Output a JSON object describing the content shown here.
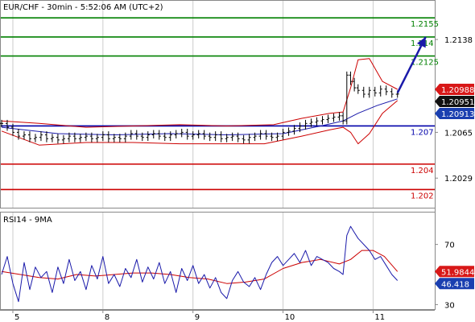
{
  "chart_data": [
    {
      "type": "line",
      "title": "EUR/CHF - 30min - 5:52:06 AM (UTC+2)",
      "subtype": "ohlc-bars",
      "ylim": [
        1.2007,
        1.2164
      ],
      "y_ticks": [
        "1.2138",
        "1.2065",
        "1.2029"
      ],
      "x_ticks": [
        {
          "label": "5",
          "x": 6
        },
        {
          "label": "8",
          "x": 54
        },
        {
          "label": "9",
          "x": 102
        },
        {
          "label": "10",
          "x": 150
        },
        {
          "label": "11",
          "x": 198
        }
      ],
      "xlim": [
        0,
        230
      ],
      "grid": "vertical",
      "levels": [
        {
          "value": 1.2155,
          "label": "1.2155",
          "color": "#008000"
        },
        {
          "value": 1.214,
          "label": "1.214",
          "color": "#008000"
        },
        {
          "value": 1.2125,
          "label": "1.2125",
          "color": "#008000"
        },
        {
          "value": 1.207,
          "label": "1.207",
          "color": "#0000aa"
        },
        {
          "value": 1.204,
          "label": "1.204",
          "color": "#cc0000"
        },
        {
          "value": 1.202,
          "label": "1.202",
          "color": "#cc0000"
        }
      ],
      "price_tags": [
        {
          "value": 1.20988,
          "label": "1.20988",
          "bg": "#d81818",
          "fg": "#ffffff"
        },
        {
          "value": 1.20951,
          "label": "1.20951",
          "bg": "#111111",
          "fg": "#ffffff"
        },
        {
          "value": 1.20913,
          "label": "1.20913",
          "bg": "#1a3fb0",
          "fg": "#ffffff"
        }
      ],
      "arrow": {
        "from": [
          211,
          1.2096
        ],
        "to": [
          226,
          1.214
        ],
        "color": "#1a1aaa"
      },
      "series": [
        {
          "name": "Price",
          "color": "#000000",
          "points": [
            [
              0,
              1.2072
            ],
            [
              3,
              1.2069
            ],
            [
              6,
              1.2065
            ],
            [
              9,
              1.2062
            ],
            [
              12,
              1.2063
            ],
            [
              15,
              1.206
            ],
            [
              18,
              1.2061
            ],
            [
              21,
              1.2063
            ],
            [
              24,
              1.206
            ],
            [
              27,
              1.2061
            ],
            [
              30,
              1.2059
            ],
            [
              33,
              1.206
            ],
            [
              36,
              1.2062
            ],
            [
              39,
              1.206
            ],
            [
              42,
              1.2061
            ],
            [
              45,
              1.2062
            ],
            [
              48,
              1.206
            ],
            [
              51,
              1.2061
            ],
            [
              54,
              1.2063
            ],
            [
              57,
              1.206
            ],
            [
              60,
              1.2061
            ],
            [
              63,
              1.206
            ],
            [
              66,
              1.2062
            ],
            [
              69,
              1.2064
            ],
            [
              72,
              1.2062
            ],
            [
              75,
              1.2061
            ],
            [
              78,
              1.2063
            ],
            [
              81,
              1.2064
            ],
            [
              84,
              1.2062
            ],
            [
              87,
              1.2061
            ],
            [
              90,
              1.2063
            ],
            [
              93,
              1.2064
            ],
            [
              96,
              1.2065
            ],
            [
              99,
              1.2062
            ],
            [
              102,
              1.2063
            ],
            [
              105,
              1.2064
            ],
            [
              108,
              1.2062
            ],
            [
              111,
              1.2061
            ],
            [
              114,
              1.2063
            ],
            [
              117,
              1.206
            ],
            [
              120,
              1.2061
            ],
            [
              123,
              1.2062
            ],
            [
              126,
              1.206
            ],
            [
              129,
              1.2059
            ],
            [
              132,
              1.2061
            ],
            [
              135,
              1.2062
            ],
            [
              138,
              1.2064
            ],
            [
              141,
              1.2062
            ],
            [
              144,
              1.2061
            ],
            [
              147,
              1.2062
            ],
            [
              150,
              1.2065
            ],
            [
              153,
              1.2066
            ],
            [
              156,
              1.2068
            ],
            [
              159,
              1.207
            ],
            [
              162,
              1.2072
            ],
            [
              165,
              1.2073
            ],
            [
              168,
              1.2074
            ],
            [
              171,
              1.2075
            ],
            [
              174,
              1.2076
            ],
            [
              177,
              1.2077
            ],
            [
              180,
              1.2078
            ],
            [
              182,
              1.2074
            ],
            [
              184,
              1.211
            ],
            [
              186,
              1.2105
            ],
            [
              188,
              1.21
            ],
            [
              190,
              1.2098
            ],
            [
              193,
              1.2095
            ],
            [
              196,
              1.2098
            ],
            [
              199,
              1.2096
            ],
            [
              202,
              1.2099
            ],
            [
              205,
              1.2097
            ],
            [
              208,
              1.2095
            ],
            [
              211,
              1.20951
            ]
          ]
        },
        {
          "name": "Bollinger Upper",
          "color": "#cc0000",
          "points": [
            [
              0,
              1.2074
            ],
            [
              20,
              1.2072
            ],
            [
              45,
              1.2069
            ],
            [
              70,
              1.207
            ],
            [
              95,
              1.2071
            ],
            [
              120,
              1.207
            ],
            [
              145,
              1.2071
            ],
            [
              160,
              1.2076
            ],
            [
              175,
              1.208
            ],
            [
              182,
              1.2081
            ],
            [
              186,
              1.21
            ],
            [
              190,
              1.2122
            ],
            [
              196,
              1.2123
            ],
            [
              203,
              1.2105
            ],
            [
              211,
              1.20988
            ]
          ]
        },
        {
          "name": "Bollinger Middle",
          "color": "#1a1aaa",
          "points": [
            [
              0,
              1.2069
            ],
            [
              30,
              1.2064
            ],
            [
              60,
              1.2063
            ],
            [
              90,
              1.2064
            ],
            [
              120,
              1.2063
            ],
            [
              150,
              1.2064
            ],
            [
              170,
              1.207
            ],
            [
              182,
              1.2074
            ],
            [
              190,
              1.208
            ],
            [
              200,
              1.2086
            ],
            [
              211,
              1.20913
            ]
          ]
        },
        {
          "name": "Bollinger Lower",
          "color": "#cc0000",
          "points": [
            [
              0,
              1.2066
            ],
            [
              20,
              1.2055
            ],
            [
              45,
              1.2057
            ],
            [
              70,
              1.2057
            ],
            [
              95,
              1.2056
            ],
            [
              120,
              1.2056
            ],
            [
              140,
              1.2056
            ],
            [
              160,
              1.2062
            ],
            [
              175,
              1.2067
            ],
            [
              182,
              1.2069
            ],
            [
              186,
              1.2065
            ],
            [
              190,
              1.2056
            ],
            [
              196,
              1.2064
            ],
            [
              203,
              1.208
            ],
            [
              211,
              1.209
            ]
          ]
        }
      ]
    },
    {
      "type": "line",
      "title": "RSI14 - 9MA",
      "ylim": [
        27,
        88
      ],
      "y_ticks": [
        "70",
        "30"
      ],
      "x_ticks": [
        "5",
        "8",
        "9",
        "10",
        "11"
      ],
      "xlim": [
        0,
        230
      ],
      "grid": "vertical",
      "price_tags": [
        {
          "value": 51.9844,
          "label": "51.9844",
          "bg": "#d81818",
          "fg": "#ffffff"
        },
        {
          "value": 46.418,
          "label": "46.418",
          "bg": "#1a3fb0",
          "fg": "#ffffff"
        }
      ],
      "series": [
        {
          "name": "RSI14",
          "color": "#1a1aaa",
          "points": [
            [
              0,
              50
            ],
            [
              3,
              62
            ],
            [
              6,
              44
            ],
            [
              9,
              32
            ],
            [
              12,
              58
            ],
            [
              15,
              40
            ],
            [
              18,
              55
            ],
            [
              21,
              48
            ],
            [
              24,
              52
            ],
            [
              27,
              38
            ],
            [
              30,
              55
            ],
            [
              33,
              44
            ],
            [
              36,
              60
            ],
            [
              39,
              46
            ],
            [
              42,
              52
            ],
            [
              45,
              40
            ],
            [
              48,
              56
            ],
            [
              51,
              47
            ],
            [
              54,
              62
            ],
            [
              57,
              44
            ],
            [
              60,
              50
            ],
            [
              63,
              42
            ],
            [
              66,
              54
            ],
            [
              69,
              48
            ],
            [
              72,
              60
            ],
            [
              75,
              45
            ],
            [
              78,
              55
            ],
            [
              81,
              47
            ],
            [
              84,
              58
            ],
            [
              87,
              44
            ],
            [
              90,
              52
            ],
            [
              93,
              38
            ],
            [
              96,
              54
            ],
            [
              99,
              46
            ],
            [
              102,
              56
            ],
            [
              105,
              44
            ],
            [
              108,
              50
            ],
            [
              111,
              41
            ],
            [
              114,
              48
            ],
            [
              117,
              38
            ],
            [
              120,
              34
            ],
            [
              123,
              46
            ],
            [
              126,
              52
            ],
            [
              129,
              45
            ],
            [
              132,
              42
            ],
            [
              135,
              48
            ],
            [
              138,
              40
            ],
            [
              141,
              50
            ],
            [
              144,
              58
            ],
            [
              147,
              62
            ],
            [
              150,
              56
            ],
            [
              153,
              60
            ],
            [
              156,
              64
            ],
            [
              159,
              58
            ],
            [
              162,
              66
            ],
            [
              165,
              56
            ],
            [
              168,
              62
            ],
            [
              171,
              60
            ],
            [
              174,
              58
            ],
            [
              177,
              54
            ],
            [
              180,
              52
            ],
            [
              182,
              50
            ],
            [
              184,
              76
            ],
            [
              186,
              82
            ],
            [
              188,
              78
            ],
            [
              190,
              74
            ],
            [
              193,
              70
            ],
            [
              196,
              66
            ],
            [
              199,
              60
            ],
            [
              202,
              62
            ],
            [
              205,
              56
            ],
            [
              208,
              50
            ],
            [
              211,
              46
            ]
          ]
        },
        {
          "name": "9MA",
          "color": "#cc0000",
          "points": [
            [
              0,
              52
            ],
            [
              10,
              50
            ],
            [
              20,
              48
            ],
            [
              30,
              47
            ],
            [
              40,
              50
            ],
            [
              50,
              49
            ],
            [
              60,
              50
            ],
            [
              70,
              51
            ],
            [
              80,
              51
            ],
            [
              90,
              50
            ],
            [
              100,
              48
            ],
            [
              110,
              47
            ],
            [
              120,
              44
            ],
            [
              130,
              45
            ],
            [
              140,
              47
            ],
            [
              150,
              54
            ],
            [
              160,
              58
            ],
            [
              170,
              60
            ],
            [
              180,
              57
            ],
            [
              186,
              60
            ],
            [
              192,
              66
            ],
            [
              198,
              66
            ],
            [
              204,
              62
            ],
            [
              211,
              52
            ]
          ]
        }
      ]
    }
  ]
}
